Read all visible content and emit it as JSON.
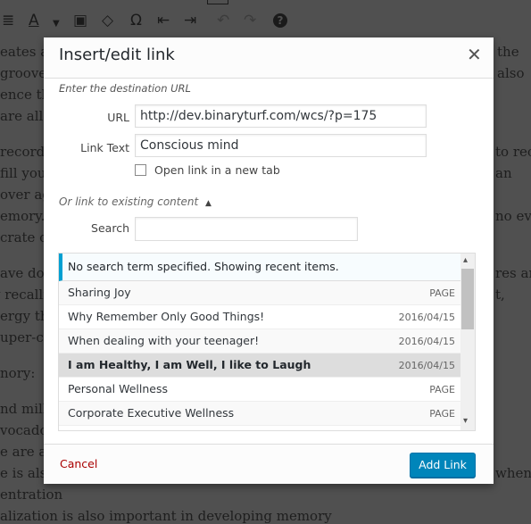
{
  "background_text": {
    "left": [
      "eates a",
      "grooves",
      "ence th",
      "are all",
      "record",
      "fill you",
      "over ag",
      "emory.",
      "crate o",
      "ave do",
      "v recalli",
      "ergy tho",
      "uper-co",
      "nory:",
      "nd milk",
      "vocado",
      "e are al",
      "e is als",
      "entration",
      "alization is also important in developing memory"
    ],
    "right": [
      "the",
      "also",
      "to reca",
      "an",
      "no evi",
      "res and",
      "t,",
      "when"
    ]
  },
  "toolbar": {
    "icons": [
      "align-justify-icon",
      "text-color-icon",
      "paste-text-icon",
      "clear-formatting-icon",
      "special-character-icon",
      "outdent-icon",
      "indent-icon",
      "undo-icon",
      "redo-icon",
      "help-icon"
    ]
  },
  "dialog": {
    "title": "Insert/edit link",
    "hint": "Enter the destination URL",
    "url_label": "URL",
    "url_value": "http://dev.binaryturf.com/wcs/?p=175",
    "link_text_label": "Link Text",
    "link_text_value": "Conscious mind",
    "new_tab_label": "Open link in a new tab",
    "new_tab_checked": false,
    "existing_toggle": "Or link to existing content",
    "search_label": "Search",
    "search_value": "",
    "notice": "No search term specified. Showing recent items.",
    "results": [
      {
        "title": "Sharing Joy",
        "meta": "PAGE"
      },
      {
        "title": "Why Remember Only Good Things!",
        "meta": "2016/04/15"
      },
      {
        "title": "When dealing with your teenager!",
        "meta": "2016/04/15"
      },
      {
        "title": "I am Healthy, I am Well, I like to Laugh",
        "meta": "2016/04/15",
        "selected": true
      },
      {
        "title": "Personal Wellness",
        "meta": "PAGE"
      },
      {
        "title": "Corporate Executive Wellness",
        "meta": "PAGE"
      }
    ],
    "cancel": "Cancel",
    "submit": "Add Link",
    "colors": {
      "accent": "#0085ba",
      "notice_border": "#00a0d2",
      "cancel": "#aa0000"
    }
  }
}
